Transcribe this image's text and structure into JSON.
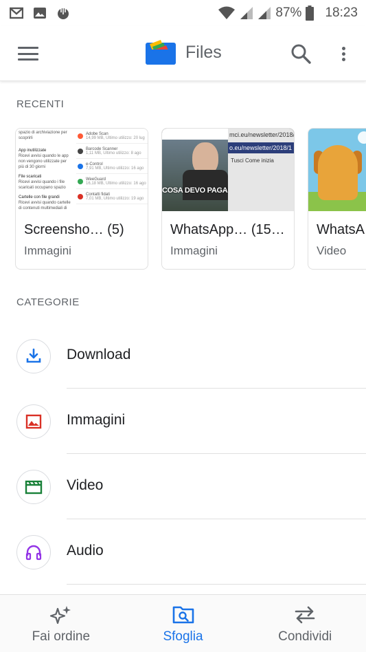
{
  "status_bar": {
    "battery": "87%",
    "time": "18:23",
    "icons": [
      "gmail-icon",
      "gallery-icon",
      "app-icon",
      "wifi-icon",
      "signal-icon",
      "signal-icon-2",
      "battery-icon"
    ]
  },
  "app_bar": {
    "title": "Files",
    "left_icon": "menu-icon",
    "right_icons": [
      "search-icon",
      "more-vert-icon"
    ]
  },
  "recent": {
    "section_label": "RECENTI",
    "cards": [
      {
        "title": "Screensho… (5)",
        "subtitle": "Immagini",
        "thumb": "screenshot-list",
        "thumb_text": {
          "left": [
            "spazio di archiviazione per scoprirli",
            "App inutilizzate",
            "Ricevi avvisi quando le app non vengono utilizzate per più di 30 giorni",
            "File scaricati",
            "Ricevi avvisi quando i file scaricati occupano spazio",
            "Cartelle con file grandi",
            "Ricevi avvisi quando cartelle di contenuti multimediali di grandi dimensioni occupano spazio"
          ],
          "right": [
            {
              "name": "Adobe Scan",
              "meta": "14,99 MB, Ultimo utilizzo: 20 lug"
            },
            {
              "name": "Barcode Scanner",
              "meta": "1,11 MB, Ultimo utilizzo: 8 ago"
            },
            {
              "name": "e-Control",
              "meta": "7,91 MB, Ultimo utilizzo: 16 ago"
            },
            {
              "name": "WeeGuard",
              "meta": "16,18 MB, Ultimo utilizzo: 16 ago"
            },
            {
              "name": "Contatti fidati",
              "meta": "7,01 MB, Ultimo utilizzo: 19 ago"
            }
          ]
        }
      },
      {
        "title": "WhatsApp… (15…",
        "subtitle": "Immagini",
        "thumb": "whatsapp-images",
        "thumb_text": {
          "caption": "COSA DEVO PAGARE",
          "url_fragment": "mci.eu/newsletter/2018/",
          "url_fragment_2": "o.eu/newsletter/2018/1",
          "page_text": "Tusci  Come inizia"
        }
      },
      {
        "title": "WhatsA",
        "subtitle": "Video",
        "thumb": "whatsapp-video"
      }
    ]
  },
  "categories": {
    "section_label": "CATEGORIE",
    "items": [
      {
        "label": "Download",
        "icon": "download-icon",
        "color": "#1a73e8"
      },
      {
        "label": "Immagini",
        "icon": "image-icon",
        "color": "#d93025"
      },
      {
        "label": "Video",
        "icon": "video-icon",
        "color": "#188038"
      },
      {
        "label": "Audio",
        "icon": "headphones-icon",
        "color": "#9334e6"
      }
    ]
  },
  "bottom_nav": {
    "items": [
      {
        "label": "Fai ordine",
        "icon": "sparkle-icon",
        "active": false
      },
      {
        "label": "Sfoglia",
        "icon": "browse-folder-icon",
        "active": true
      },
      {
        "label": "Condividi",
        "icon": "swap-arrows-icon",
        "active": false
      }
    ],
    "active_color": "#1a73e8"
  }
}
